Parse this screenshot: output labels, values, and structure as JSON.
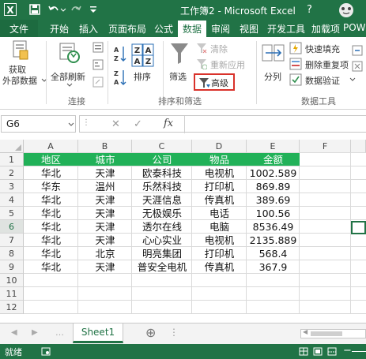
{
  "title_bar": {
    "title": "工作簿2 - Microsoft Excel",
    "help_label": "?"
  },
  "tabs": [
    {
      "label": "文件"
    },
    {
      "label": "开始"
    },
    {
      "label": "插入"
    },
    {
      "label": "页面布局"
    },
    {
      "label": "公式"
    },
    {
      "label": "数据"
    },
    {
      "label": "审阅"
    },
    {
      "label": "视图"
    },
    {
      "label": "开发工具"
    },
    {
      "label": "加载项"
    },
    {
      "label": "POW"
    }
  ],
  "active_tab": "数据",
  "ribbon": {
    "get_external_line1": "获取",
    "get_external_line2": "外部数据",
    "refresh_all": "全部刷新",
    "group_connections": "连接",
    "sort_label": "排序",
    "filter_label": "筛选",
    "clear_label": "清除",
    "reapply_label": "重新应用",
    "advanced_label": "高级",
    "group_sort_filter": "排序和筛选",
    "split_label": "分列",
    "flash_fill_label": "快速填充",
    "remove_dup_label": "删除重复项",
    "validation_label": "数据验证",
    "group_data_tools": "数据工具"
  },
  "formula_bar": {
    "name_box": "G6",
    "fx_label": "fx",
    "cancel_label": "✕",
    "enter_label": "✓",
    "formula": ""
  },
  "columns": [
    "A",
    "B",
    "C",
    "D",
    "E",
    "F"
  ],
  "row_numbers": [
    "1",
    "2",
    "3",
    "4",
    "5",
    "6",
    "7",
    "8",
    "9",
    "10",
    "11",
    "12"
  ],
  "header_row": [
    "地区",
    "城市",
    "公司",
    "物品",
    "金额"
  ],
  "rows": [
    [
      "华北",
      "天津",
      "欧泰科技",
      "电视机",
      "1002.589"
    ],
    [
      "华东",
      "温州",
      "乐然科技",
      "打印机",
      "869.89"
    ],
    [
      "华北",
      "天津",
      "天涯信息",
      "传真机",
      "389.69"
    ],
    [
      "华北",
      "天津",
      "无极娱乐",
      "电话",
      "100.56"
    ],
    [
      "华北",
      "天津",
      "透尔在线",
      "电脑",
      "8536.49"
    ],
    [
      "华北",
      "天津",
      "心心实业",
      "电视机",
      "2135.889"
    ],
    [
      "华北",
      "北京",
      "明亮集团",
      "打印机",
      "568.4"
    ],
    [
      "华北",
      "天津",
      "普安全电机",
      "传真机",
      "367.9"
    ]
  ],
  "sheet_tabs": [
    {
      "label": "Sheet1"
    }
  ],
  "add_sheet_label": "⊕",
  "status": {
    "mode": "就绪"
  },
  "colors": {
    "excel_green": "#217346",
    "header_fill": "#21b158",
    "advanced_highlight": "#d9322b"
  }
}
